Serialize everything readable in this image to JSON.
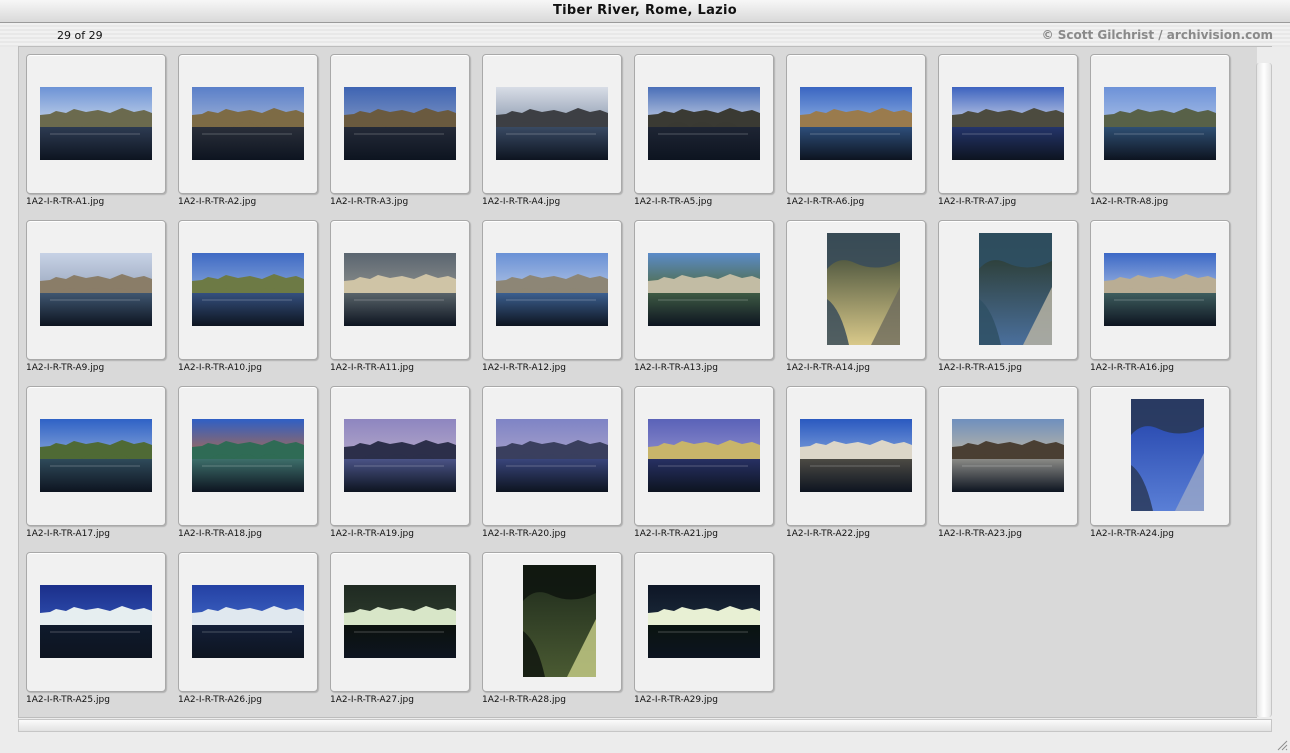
{
  "window": {
    "title": "Tiber River, Rome, Lazio"
  },
  "header": {
    "count": "29 of 29",
    "copyright": "© Scott Gilchrist / archivision.com"
  },
  "grid": {
    "items": [
      {
        "caption": "1A2-I-R-TR-A1.jpg",
        "orientation": "landscape",
        "palette": [
          "#6d93d6",
          "#c9d7ea",
          "#6b6a4e",
          "#2d3b52"
        ]
      },
      {
        "caption": "1A2-I-R-TR-A2.jpg",
        "orientation": "landscape",
        "palette": [
          "#5a7fc9",
          "#9fb2d6",
          "#7d6b45",
          "#2a2f3a"
        ]
      },
      {
        "caption": "1A2-I-R-TR-A3.jpg",
        "orientation": "landscape",
        "palette": [
          "#3e64b3",
          "#7f95c2",
          "#6a5a3f",
          "#242a38"
        ]
      },
      {
        "caption": "1A2-I-R-TR-A4.jpg",
        "orientation": "landscape",
        "palette": [
          "#d8dde6",
          "#8a98ae",
          "#3d3f44",
          "#394a63"
        ]
      },
      {
        "caption": "1A2-I-R-TR-A5.jpg",
        "orientation": "landscape",
        "palette": [
          "#4a6fb8",
          "#c9d3e6",
          "#3a3a33",
          "#1e2534"
        ]
      },
      {
        "caption": "1A2-I-R-TR-A6.jpg",
        "orientation": "landscape",
        "palette": [
          "#3a66c2",
          "#8fb0e2",
          "#9a7b4d",
          "#2e4e7a"
        ]
      },
      {
        "caption": "1A2-I-R-TR-A7.jpg",
        "orientation": "landscape",
        "palette": [
          "#3d63bf",
          "#cfd7ea",
          "#4c4b3f",
          "#24356a"
        ]
      },
      {
        "caption": "1A2-I-R-TR-A8.jpg",
        "orientation": "landscape",
        "palette": [
          "#6d92d8",
          "#a8bfe6",
          "#586148",
          "#2f4f73"
        ]
      },
      {
        "caption": "1A2-I-R-TR-A9.jpg",
        "orientation": "landscape",
        "palette": [
          "#c7d2e6",
          "#9aa7bd",
          "#8a7d68",
          "#3f5670"
        ]
      },
      {
        "caption": "1A2-I-R-TR-A10.jpg",
        "orientation": "landscape",
        "palette": [
          "#3f6ac4",
          "#86a5d9",
          "#6d7a45",
          "#35507e"
        ]
      },
      {
        "caption": "1A2-I-R-TR-A11.jpg",
        "orientation": "landscape",
        "palette": [
          "#5a6570",
          "#8c8f8c",
          "#cfc4a6",
          "#59646a"
        ]
      },
      {
        "caption": "1A2-I-R-TR-A12.jpg",
        "orientation": "landscape",
        "palette": [
          "#6a91d6",
          "#b0c3e3",
          "#8d8676",
          "#3c5f8f"
        ]
      },
      {
        "caption": "1A2-I-R-TR-A13.jpg",
        "orientation": "landscape",
        "palette": [
          "#5b8bc9",
          "#4f6a3a",
          "#c2bca4",
          "#3e5a44"
        ]
      },
      {
        "caption": "1A2-I-R-TR-A14.jpg",
        "orientation": "portrait",
        "palette": [
          "#2c3a2c",
          "#d9c98a",
          "#6d6a5c",
          "#3a4c5a"
        ]
      },
      {
        "caption": "1A2-I-R-TR-A15.jpg",
        "orientation": "portrait",
        "palette": [
          "#26331f",
          "#4a6f9c",
          "#bdb6a4",
          "#2f5064"
        ]
      },
      {
        "caption": "1A2-I-R-TR-A16.jpg",
        "orientation": "landscape",
        "palette": [
          "#3c68c6",
          "#9fb7e0",
          "#b9ad94",
          "#3e5d5e"
        ]
      },
      {
        "caption": "1A2-I-R-TR-A17.jpg",
        "orientation": "landscape",
        "palette": [
          "#2f62c6",
          "#89a6d8",
          "#4f6a35",
          "#2f4a5a"
        ]
      },
      {
        "caption": "1A2-I-R-TR-A18.jpg",
        "orientation": "landscape",
        "palette": [
          "#2f5fc5",
          "#b06b4a",
          "#2f6b55",
          "#3d6e6a"
        ]
      },
      {
        "caption": "1A2-I-R-TR-A19.jpg",
        "orientation": "landscape",
        "palette": [
          "#8e86c0",
          "#b3a7c9",
          "#2c2f4a",
          "#4a5386"
        ]
      },
      {
        "caption": "1A2-I-R-TR-A20.jpg",
        "orientation": "landscape",
        "palette": [
          "#7e84c6",
          "#a7a0c9",
          "#3a3f5e",
          "#39457b"
        ]
      },
      {
        "caption": "1A2-I-R-TR-A21.jpg",
        "orientation": "landscape",
        "palette": [
          "#5a62b8",
          "#8d8ccb",
          "#c8b56a",
          "#273063"
        ]
      },
      {
        "caption": "1A2-I-R-TR-A22.jpg",
        "orientation": "landscape",
        "palette": [
          "#2a59c0",
          "#7fa0da",
          "#dcd6c8",
          "#4c4a44"
        ]
      },
      {
        "caption": "1A2-I-R-TR-A23.jpg",
        "orientation": "landscape",
        "palette": [
          "#6f8fbe",
          "#bfb7a4",
          "#4a3f33",
          "#8a8a86"
        ]
      },
      {
        "caption": "1A2-I-R-TR-A24.jpg",
        "orientation": "portrait",
        "palette": [
          "#1f3fa8",
          "#5a7fd6",
          "#9aa8c8",
          "#2a3a5a"
        ]
      },
      {
        "caption": "1A2-I-R-TR-A25.jpg",
        "orientation": "landscape",
        "palette": [
          "#1b2f8a",
          "#2f4fb0",
          "#e6eef0",
          "#0f1a2c"
        ]
      },
      {
        "caption": "1A2-I-R-TR-A26.jpg",
        "orientation": "landscape",
        "palette": [
          "#2441a4",
          "#3d63c2",
          "#e0e8ef",
          "#141f38"
        ]
      },
      {
        "caption": "1A2-I-R-TR-A27.jpg",
        "orientation": "landscape",
        "palette": [
          "#1f2a22",
          "#2d3a2c",
          "#d8e6c8",
          "#0c120e"
        ]
      },
      {
        "caption": "1A2-I-R-TR-A28.jpg",
        "orientation": "portrait",
        "palette": [
          "#1c281b",
          "#4a5a32",
          "#c9d08a",
          "#10160f"
        ]
      },
      {
        "caption": "1A2-I-R-TR-A29.jpg",
        "orientation": "landscape",
        "palette": [
          "#0e1626",
          "#1b2a3a",
          "#e8f0d4",
          "#0a1410"
        ]
      }
    ]
  }
}
